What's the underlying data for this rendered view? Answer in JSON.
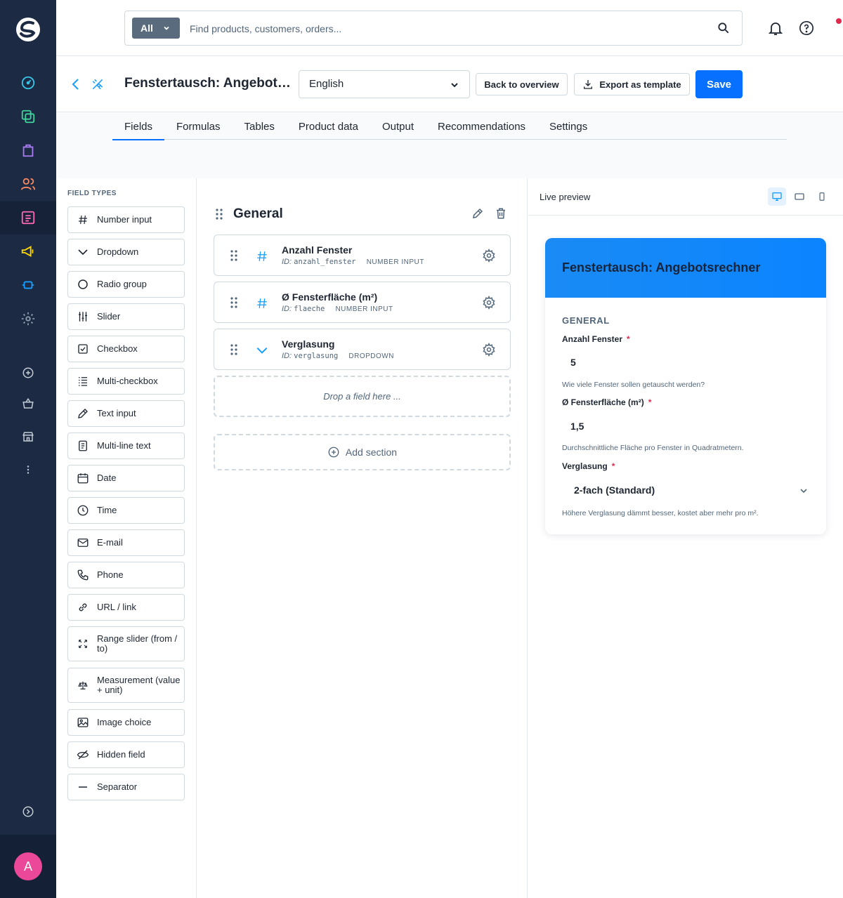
{
  "colors": {
    "accent": "#0870ff",
    "rail": "#1c2a43",
    "notify": "#de294c",
    "avatar": "#ec4899"
  },
  "search": {
    "scope": "All",
    "placeholder": "Find products, customers, orders..."
  },
  "user": {
    "initial": "A"
  },
  "header": {
    "title": "Fenstertausch: Angebotsr...",
    "language": "English",
    "back_label": "Back to overview",
    "export_label": "Export as template",
    "save_label": "Save"
  },
  "tabs": [
    "Fields",
    "Formulas",
    "Tables",
    "Product data",
    "Output",
    "Recommendations",
    "Settings"
  ],
  "field_types": {
    "title": "FIELD TYPES",
    "items": [
      {
        "label": "Number input",
        "icon": "hash-icon"
      },
      {
        "label": "Dropdown",
        "icon": "chevron-down-icon"
      },
      {
        "label": "Radio group",
        "icon": "radio-icon"
      },
      {
        "label": "Slider",
        "icon": "sliders-icon"
      },
      {
        "label": "Checkbox",
        "icon": "checkbox-icon"
      },
      {
        "label": "Multi-checkbox",
        "icon": "list-icon"
      },
      {
        "label": "Text input",
        "icon": "pencil-icon"
      },
      {
        "label": "Multi-line text",
        "icon": "document-icon"
      },
      {
        "label": "Date",
        "icon": "calendar-icon"
      },
      {
        "label": "Time",
        "icon": "clock-icon"
      },
      {
        "label": "E-mail",
        "icon": "mail-icon"
      },
      {
        "label": "Phone",
        "icon": "phone-icon"
      },
      {
        "label": "URL / link",
        "icon": "link-icon"
      },
      {
        "label": "Range slider (from / to)",
        "icon": "expand-icon"
      },
      {
        "label": "Measurement (value + unit)",
        "icon": "scale-icon"
      },
      {
        "label": "Image choice",
        "icon": "image-icon"
      },
      {
        "label": "Hidden field",
        "icon": "eye-off-icon"
      },
      {
        "label": "Separator",
        "icon": "minus-icon"
      }
    ]
  },
  "builder": {
    "section_title": "General",
    "fields": [
      {
        "name": "Anzahl Fenster",
        "id_label": "ID:",
        "id": "anzahl_fenster",
        "type": "NUMBER INPUT",
        "icon": "hash-icon"
      },
      {
        "name": "Ø Fensterfläche (m²)",
        "id_label": "ID:",
        "id": "flaeche",
        "type": "NUMBER INPUT",
        "icon": "hash-icon"
      },
      {
        "name": "Verglasung",
        "id_label": "ID:",
        "id": "verglasung",
        "type": "DROPDOWN",
        "icon": "chevron-down-icon"
      }
    ],
    "drop_placeholder": "Drop a field here ...",
    "add_section": "Add section"
  },
  "preview": {
    "title": "Live preview",
    "card_title": "Fenstertausch: Angebotsrechner",
    "section": "GENERAL",
    "required_mark": "*",
    "fields": [
      {
        "label": "Anzahl Fenster",
        "value": "5",
        "help": "Wie viele Fenster sollen getauscht werden?"
      },
      {
        "label": "Ø Fensterfläche (m²)",
        "value": "1,5",
        "help": "Durchschnittliche Fläche pro Fenster in Quadratmetern."
      },
      {
        "label": "Verglasung",
        "value": "2-fach (Standard)",
        "help": "Höhere Verglasung dämmt besser, kostet aber mehr pro m²."
      }
    ]
  }
}
